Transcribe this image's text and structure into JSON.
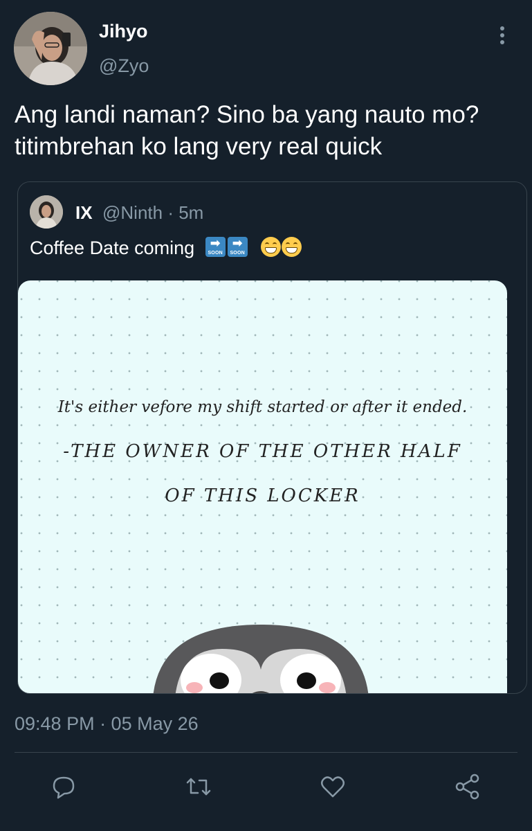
{
  "tweet": {
    "author_name": "Jihyo",
    "author_handle": "@Zyo",
    "text_line1": "Ang landi naman? Sino ba yang nauto mo?",
    "text_line2": "titimbrehan ko lang very real quick",
    "timestamp": "09:48 PM · 05 May 26"
  },
  "quoted": {
    "author_name": "IX",
    "author_handle": "@Ninth · 5m",
    "text": "Coffee Date coming",
    "emoji": [
      "soon-arrow",
      "soon-arrow",
      "grinning-face",
      "grinning-face"
    ],
    "emoji_soon_label": "SOON",
    "image": {
      "line1": "It's either vefore my shift started or after it ended.",
      "line2": "-THE OWNER OF THE OTHER HALF",
      "line3": "OF THIS LOCKER"
    }
  },
  "actions": [
    "reply-icon",
    "retweet-icon",
    "like-icon",
    "share-icon"
  ],
  "colors": {
    "background": "#15202b",
    "secondary_text": "#8899a6",
    "border": "#38444d",
    "image_background": "#e9fbfb"
  }
}
